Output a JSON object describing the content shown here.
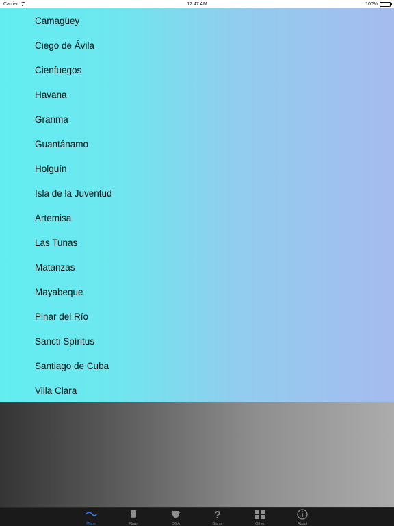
{
  "status_bar": {
    "carrier": "Carrier",
    "time": "12:47 AM",
    "battery": "100%",
    "battery_level": 1.0
  },
  "list": {
    "items": [
      {
        "label": "Camagüey"
      },
      {
        "label": "Ciego de Ávila"
      },
      {
        "label": "Cienfuegos"
      },
      {
        "label": "Havana"
      },
      {
        "label": "Granma"
      },
      {
        "label": "Guantánamo"
      },
      {
        "label": "Holguín"
      },
      {
        "label": "Isla de la Juventud"
      },
      {
        "label": "Artemisa"
      },
      {
        "label": "Las Tunas"
      },
      {
        "label": "Matanzas"
      },
      {
        "label": "Mayabeque"
      },
      {
        "label": "Pinar del Río"
      },
      {
        "label": "Sancti Spíritus"
      },
      {
        "label": "Santiago de Cuba"
      },
      {
        "label": "Villa Clara"
      }
    ]
  },
  "tab_bar": {
    "tabs": [
      {
        "label": "Maps",
        "icon": "wave-icon",
        "active": true
      },
      {
        "label": "Flags",
        "icon": "flag-book-icon",
        "active": false
      },
      {
        "label": "COA",
        "icon": "shield-icon",
        "active": false
      },
      {
        "label": "Game",
        "icon": "question-icon",
        "active": false
      },
      {
        "label": "Other",
        "icon": "grid-icon",
        "active": false
      },
      {
        "label": "About",
        "icon": "info-icon",
        "active": false
      }
    ],
    "active_color": "#2f7de0",
    "inactive_color": "#8f8f8f"
  }
}
